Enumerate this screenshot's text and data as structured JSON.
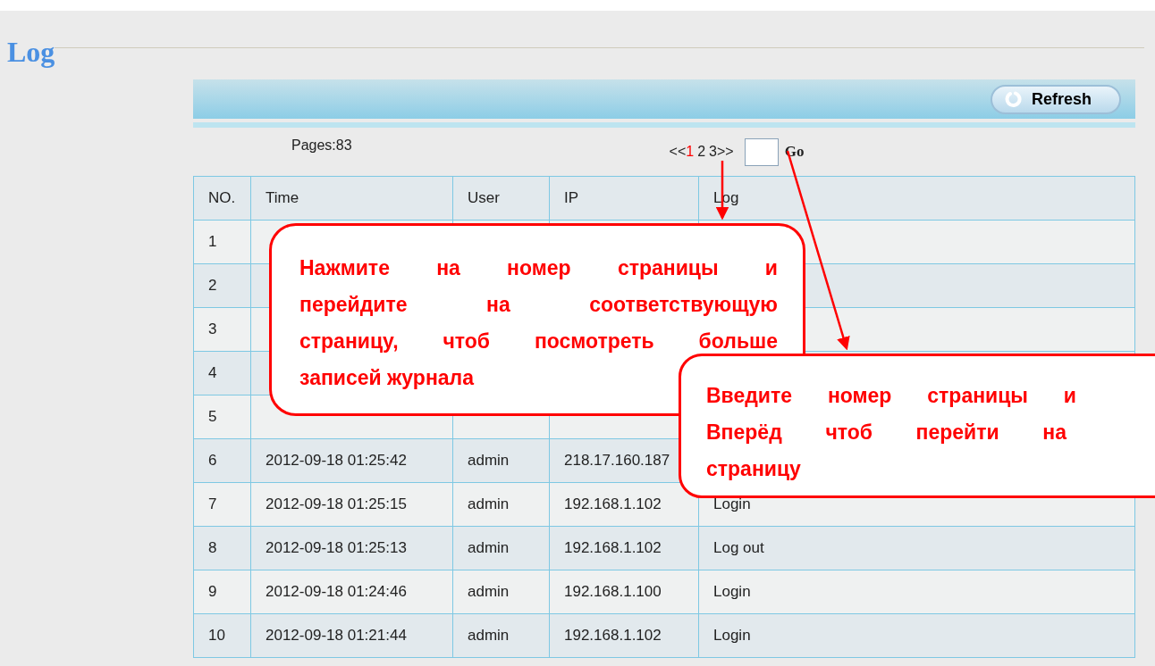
{
  "title": "Log",
  "toolbar": {
    "refresh_button": "Refresh"
  },
  "pagination": {
    "pages_count": "Pages:83",
    "prev": "<<",
    "pages": [
      {
        "label": "1",
        "selected": true
      },
      {
        "label": "2",
        "selected": false
      },
      {
        "label": "3",
        "selected": false
      }
    ],
    "next": ">>",
    "go_button": "Go"
  },
  "table": {
    "columns": [
      "NO.",
      "Time",
      "User",
      "IP",
      "Log"
    ],
    "rows": [
      [
        "1",
        "",
        "",
        "",
        ""
      ],
      [
        "2",
        "",
        "",
        "",
        ""
      ],
      [
        "3",
        "",
        "",
        "",
        ""
      ],
      [
        "4",
        "",
        "",
        "",
        ""
      ],
      [
        "5",
        "",
        "",
        "",
        ""
      ],
      [
        "6",
        "2012-09-18 01:25:42",
        "admin",
        "218.17.160.187",
        ""
      ],
      [
        "7",
        "2012-09-18 01:25:15",
        "admin",
        "192.168.1.102",
        "Login"
      ],
      [
        "8",
        "2012-09-18 01:25:13",
        "admin",
        "192.168.1.102",
        "Log out"
      ],
      [
        "9",
        "2012-09-18 01:24:46",
        "admin",
        "192.168.1.100",
        "Login"
      ],
      [
        "10",
        "2012-09-18 01:21:44",
        "admin",
        "192.168.1.102",
        "Login"
      ]
    ]
  },
  "callouts": [
    {
      "lines": [
        "Нажмите на номер страницы и",
        "перейдите на соответствующую",
        "страницу, чтоб посмотреть больше",
        "записей журнала"
      ]
    },
    {
      "lines": [
        "Введите номер страницы и",
        "Вперёд чтоб перейти на",
        "страницу"
      ]
    }
  ]
}
